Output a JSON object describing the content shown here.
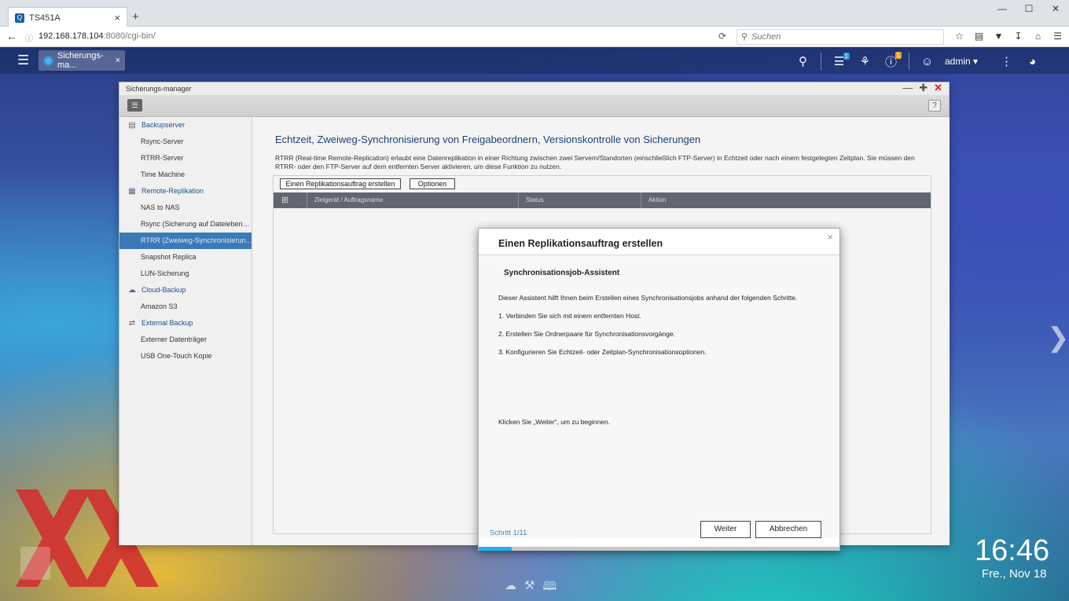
{
  "browser": {
    "tab_title": "TS451A",
    "tab_close": "×",
    "new_tab": "+",
    "url_host": "192.168.178.104",
    "url_rest": ":8080/cgi-bin/",
    "search_placeholder": "Suchen",
    "window_controls": [
      "—",
      "☐",
      "✕"
    ]
  },
  "qts": {
    "app_tab": "Sicherungs-ma...",
    "app_tab_close": "×",
    "notification_badge": "1",
    "info_badge": "1",
    "user": "admin",
    "clock": "16:46",
    "date": "Fre., Nov 18"
  },
  "app": {
    "title": "Sicherungs-manager",
    "help": "?",
    "sidebar": [
      {
        "type": "section",
        "label": "Backupserver",
        "icon": "server-icon"
      },
      {
        "type": "item",
        "label": "Rsync-Server"
      },
      {
        "type": "item",
        "label": "RTRR-Server"
      },
      {
        "type": "item",
        "label": "Time Machine"
      },
      {
        "type": "section",
        "label": "Remote-Replikation",
        "icon": "replication-icon"
      },
      {
        "type": "item",
        "label": "NAS to NAS"
      },
      {
        "type": "item",
        "label": "Rsync (Sicherung auf Dateiebene..."
      },
      {
        "type": "item",
        "label": "RTRR (Zweiweg-Synchronisierun...",
        "active": true
      },
      {
        "type": "item",
        "label": "Snapshot Replica"
      },
      {
        "type": "item",
        "label": "LUN-Sicherung"
      },
      {
        "type": "section",
        "label": "Cloud-Backup",
        "icon": "cloud-icon"
      },
      {
        "type": "item",
        "label": "Amazon S3"
      },
      {
        "type": "section",
        "label": "External Backup",
        "icon": "sync-icon"
      },
      {
        "type": "item",
        "label": "Externer Datenträger"
      },
      {
        "type": "item",
        "label": "USB One-Touch Kopie"
      }
    ],
    "main": {
      "title": "Echtzeit, Zweiweg-Synchronisierung von Freigabeordnern, Versionskontrolle von Sicherungen",
      "description": "RTRR (Real-time Remote-Replication) erlaubt eine Datenreplikation in einer Richtung zwischen zwei Servern/Standorten (einschließlich FTP-Server) in Echtzeit oder nach einem festgelegten Zeitplan. Sie müssen den RTRR- oder den FTP-Server auf dem entfernten Server aktivieren, um diese Funktion zu nutzen.",
      "create_button": "Einen Replikationsauftrag erstellen",
      "options_button": "Optionen",
      "columns": [
        "Zielgerät / Auftragsname",
        "Status",
        "Aktion"
      ]
    }
  },
  "dialog": {
    "title": "Einen Replikationsauftrag erstellen",
    "close": "×",
    "subtitle": "Synchronisationsjob-Assistent",
    "intro": "Dieser Assistent hilft Ihnen beim Erstellen eines Synchronisationsjobs anhand der folgenden Schritte.",
    "steps": [
      "1. Verbinden Sie sich mit einem entfernten Host.",
      "2. Erstellen Sie Ordnerpaare für Synchronisationsvorgänge.",
      "3. Konfigurieren Sie Echtzeit- oder Zeitplan-Synchronisationsoptionen."
    ],
    "footer_hint": "Klicken Sie „Weiter“, um zu beginnen.",
    "step_label": "Schritt 1/11",
    "progress_fraction": 0.0909,
    "next_button": "Weiter",
    "cancel_button": "Abbrechen"
  }
}
